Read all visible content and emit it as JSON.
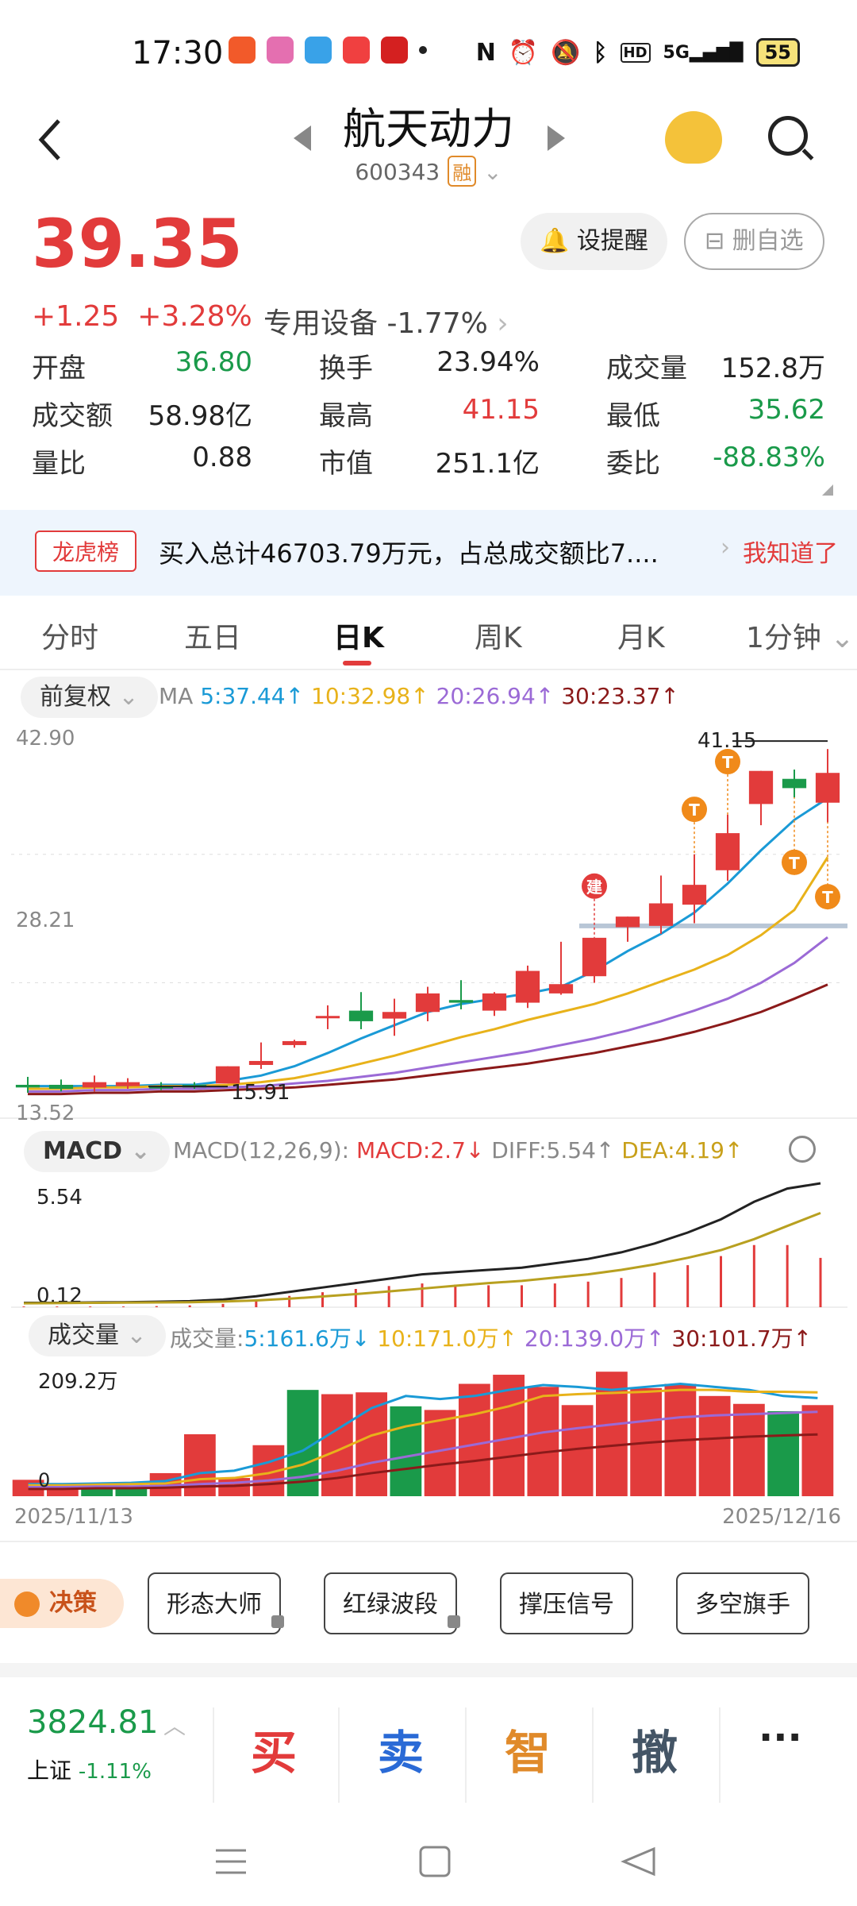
{
  "status_bar": {
    "time": "17:30",
    "network": "5G",
    "battery": "55"
  },
  "header": {
    "title": "航天动力",
    "code": "600343",
    "margin_badge": "融"
  },
  "quote": {
    "price": "39.35",
    "change": "+1.25",
    "change_pct": "+3.28%",
    "sector": "专用设备",
    "sector_change": "-1.77%",
    "alert_button": "设提醒",
    "delete_button": "删自选"
  },
  "stats": [
    {
      "label": "开盘",
      "value": "36.80",
      "color": "#1a9a4a"
    },
    {
      "label": "换手",
      "value": "23.94%",
      "color": "#222222"
    },
    {
      "label": "成交量",
      "value": "152.8万",
      "color": "#222222"
    },
    {
      "label": "成交额",
      "value": "58.98亿",
      "color": "#222222"
    },
    {
      "label": "最高",
      "value": "41.15",
      "color": "#e23b3b"
    },
    {
      "label": "最低",
      "value": "35.62",
      "color": "#1a9a4a"
    },
    {
      "label": "量比",
      "value": "0.88",
      "color": "#222222"
    },
    {
      "label": "市值",
      "value": "251.1亿",
      "color": "#222222"
    },
    {
      "label": "委比",
      "value": "-88.83%",
      "color": "#1a9a4a"
    }
  ],
  "banner": {
    "tag": "龙虎榜",
    "text": "买入总计46703.79万元，占总成交额比7....",
    "action": "我知道了"
  },
  "tabs": [
    "分时",
    "五日",
    "日K",
    "周K",
    "月K",
    "1分钟"
  ],
  "active_tab": "日K",
  "ma": {
    "adjust": "前复权",
    "label": "MA",
    "items": [
      {
        "text": "5:37.44↑",
        "color": "#1a9ad6"
      },
      {
        "text": "10:32.98↑",
        "color": "#e8b21a"
      },
      {
        "text": "20:26.94↑",
        "color": "#9b6ad6"
      },
      {
        "text": "30:23.37↑",
        "color": "#8b1a1a"
      }
    ]
  },
  "macd_header": {
    "selector": "MACD",
    "params": "MACD(12,26,9):",
    "macd": "MACD:2.7↓",
    "diff": "DIFF:5.54↑",
    "dea": "DEA:4.19↑"
  },
  "volume_header": {
    "selector": "成交量",
    "label": "成交量:",
    "items": [
      {
        "text": "5:161.6万↓",
        "color": "#1a9ad6"
      },
      {
        "text": "10:171.0万↑",
        "color": "#e8b21a"
      },
      {
        "text": "20:139.0万↑",
        "color": "#9b6ad6"
      },
      {
        "text": "30:101.7万↑",
        "color": "#8b1a1a"
      }
    ]
  },
  "chart_data": [
    {
      "type": "candlestick",
      "title": "日K",
      "ylim": [
        13.52,
        42.9
      ],
      "y_ticks": [
        "42.90",
        "28.21",
        "13.52"
      ],
      "annotations": {
        "high_label": "41.15",
        "low_label": "15.91",
        "signal_markers": [
          "建",
          "T",
          "T",
          "T",
          "T"
        ]
      },
      "candles": [
        {
          "o": 15.6,
          "h": 16.4,
          "l": 15.2,
          "c": 15.8,
          "up": false
        },
        {
          "o": 15.8,
          "h": 16.2,
          "l": 15.3,
          "c": 15.5,
          "up": false
        },
        {
          "o": 15.6,
          "h": 16.5,
          "l": 15.3,
          "c": 16.0,
          "up": true
        },
        {
          "o": 16.0,
          "h": 16.3,
          "l": 15.5,
          "c": 15.7,
          "up": true
        },
        {
          "o": 15.7,
          "h": 16.0,
          "l": 15.4,
          "c": 15.6,
          "up": false
        },
        {
          "o": 15.6,
          "h": 16.0,
          "l": 15.5,
          "c": 15.8,
          "up": false
        },
        {
          "o": 15.9,
          "h": 17.2,
          "l": 15.91,
          "c": 17.2,
          "up": true
        },
        {
          "o": 17.3,
          "h": 19.0,
          "l": 17.0,
          "c": 17.6,
          "up": true
        },
        {
          "o": 18.8,
          "h": 19.2,
          "l": 18.6,
          "c": 19.1,
          "up": true
        },
        {
          "o": 20.9,
          "h": 21.8,
          "l": 20.0,
          "c": 21.0,
          "up": true
        },
        {
          "o": 20.6,
          "h": 22.8,
          "l": 20.0,
          "c": 21.4,
          "up": false
        },
        {
          "o": 20.8,
          "h": 22.3,
          "l": 19.5,
          "c": 21.3,
          "up": true
        },
        {
          "o": 21.3,
          "h": 23.2,
          "l": 20.6,
          "c": 22.7,
          "up": true
        },
        {
          "o": 22.2,
          "h": 23.7,
          "l": 21.5,
          "c": 22.0,
          "up": false
        },
        {
          "o": 21.4,
          "h": 22.8,
          "l": 21.0,
          "c": 22.7,
          "up": true
        },
        {
          "o": 22.0,
          "h": 24.8,
          "l": 21.6,
          "c": 24.4,
          "up": true
        },
        {
          "o": 22.7,
          "h": 26.6,
          "l": 22.6,
          "c": 23.4,
          "up": true
        },
        {
          "o": 24.0,
          "h": 26.9,
          "l": 23.5,
          "c": 26.9,
          "up": true
        },
        {
          "o": 27.7,
          "h": 28.5,
          "l": 26.6,
          "c": 28.5,
          "up": true
        },
        {
          "o": 27.8,
          "h": 31.6,
          "l": 27.2,
          "c": 29.5,
          "up": true
        },
        {
          "o": 29.4,
          "h": 33.2,
          "l": 28.0,
          "c": 30.9,
          "up": true
        },
        {
          "o": 32.0,
          "h": 36.2,
          "l": 31.2,
          "c": 34.8,
          "up": true
        },
        {
          "o": 37.0,
          "h": 39.5,
          "l": 35.4,
          "c": 39.5,
          "up": true
        },
        {
          "o": 38.2,
          "h": 39.6,
          "l": 37.5,
          "c": 38.9,
          "up": false
        },
        {
          "o": 37.1,
          "h": 41.15,
          "l": 35.62,
          "c": 39.35,
          "up": true
        }
      ],
      "ma_series": [
        {
          "name": "MA5",
          "color": "#1a9ad6",
          "values": [
            15.7,
            15.7,
            15.7,
            15.7,
            15.8,
            15.8,
            16.1,
            16.5,
            17.2,
            18.2,
            19.3,
            20.3,
            21.3,
            21.9,
            22.3,
            22.7,
            23.2,
            24.4,
            25.9,
            27.2,
            28.8,
            31.0,
            33.5,
            35.8,
            37.44
          ]
        },
        {
          "name": "MA10",
          "color": "#e8b21a",
          "values": [
            15.5,
            15.5,
            15.6,
            15.6,
            15.7,
            15.7,
            15.8,
            16.0,
            16.3,
            16.8,
            17.4,
            18.0,
            18.7,
            19.4,
            20.0,
            20.7,
            21.3,
            21.9,
            22.7,
            23.6,
            24.5,
            25.6,
            27.1,
            29.0,
            32.98
          ]
        },
        {
          "name": "MA20",
          "color": "#9b6ad6",
          "values": [
            15.3,
            15.3,
            15.4,
            15.4,
            15.5,
            15.5,
            15.6,
            15.7,
            15.9,
            16.1,
            16.4,
            16.7,
            17.1,
            17.5,
            17.9,
            18.3,
            18.8,
            19.3,
            19.9,
            20.6,
            21.4,
            22.3,
            23.5,
            25.0,
            26.94
          ]
        },
        {
          "name": "MA30",
          "color": "#8b1a1a",
          "values": [
            15.1,
            15.1,
            15.2,
            15.2,
            15.3,
            15.3,
            15.4,
            15.5,
            15.6,
            15.8,
            16.0,
            16.2,
            16.5,
            16.8,
            17.1,
            17.4,
            17.8,
            18.2,
            18.7,
            19.2,
            19.8,
            20.5,
            21.3,
            22.3,
            23.37
          ]
        }
      ]
    },
    {
      "type": "macd",
      "ylim": [
        0.12,
        5.54
      ],
      "y_ticks": [
        "5.54",
        "0.12"
      ],
      "diff": [
        0.1,
        0.1,
        0.12,
        0.13,
        0.15,
        0.18,
        0.25,
        0.4,
        0.6,
        0.8,
        1.0,
        1.2,
        1.4,
        1.5,
        1.6,
        1.7,
        1.9,
        2.1,
        2.4,
        2.8,
        3.3,
        3.9,
        4.7,
        5.3,
        5.54
      ],
      "dea": [
        0.08,
        0.09,
        0.1,
        0.11,
        0.12,
        0.13,
        0.16,
        0.21,
        0.29,
        0.39,
        0.5,
        0.62,
        0.75,
        0.88,
        1.0,
        1.1,
        1.25,
        1.4,
        1.6,
        1.85,
        2.15,
        2.5,
        3.0,
        3.6,
        4.19
      ],
      "hist": [
        0.02,
        0.02,
        0.02,
        0.02,
        0.03,
        0.05,
        0.09,
        0.19,
        0.31,
        0.41,
        0.5,
        0.58,
        0.65,
        0.62,
        0.6,
        0.6,
        0.65,
        0.7,
        0.8,
        0.95,
        1.15,
        1.4,
        1.7,
        1.7,
        1.35
      ]
    },
    {
      "type": "bar",
      "title": "成交量",
      "ylim": [
        0,
        209.2
      ],
      "y_ticks": [
        "209.2万",
        "0"
      ],
      "x_labels": [
        "2025/11/13",
        "2025/12/16"
      ],
      "values": [
        27,
        19,
        18,
        14,
        38,
        102,
        30,
        84,
        175,
        168,
        171,
        148,
        142,
        185,
        200,
        180,
        150,
        205,
        178,
        185,
        165,
        152,
        140,
        150
      ],
      "up": [
        true,
        true,
        false,
        false,
        true,
        true,
        true,
        true,
        false,
        true,
        true,
        false,
        true,
        true,
        true,
        true,
        true,
        true,
        true,
        true,
        true,
        true,
        false,
        true
      ],
      "ma_series": [
        {
          "name": "MA5",
          "color": "#1a9ad6",
          "values": [
            20,
            20,
            21,
            22,
            25,
            38,
            42,
            56,
            75,
            110,
            145,
            165,
            160,
            165,
            175,
            183,
            180,
            175,
            180,
            185,
            180,
            175,
            165,
            161.6
          ]
        },
        {
          "name": "MA10",
          "color": "#e8b21a",
          "values": [
            18,
            18,
            19,
            20,
            21,
            28,
            30,
            38,
            52,
            75,
            100,
            115,
            125,
            135,
            148,
            165,
            168,
            170,
            172,
            175,
            175,
            172,
            172,
            171.0
          ]
        },
        {
          "name": "MA20",
          "color": "#9b6ad6",
          "values": [
            15,
            15,
            16,
            16,
            17,
            20,
            22,
            26,
            32,
            42,
            55,
            65,
            75,
            85,
            95,
            105,
            112,
            118,
            124,
            130,
            133,
            135,
            137,
            139.0
          ]
        },
        {
          "name": "MA30",
          "color": "#8b1a1a",
          "values": [
            12,
            12,
            13,
            13,
            14,
            16,
            17,
            20,
            24,
            30,
            38,
            45,
            52,
            58,
            65,
            72,
            78,
            83,
            88,
            92,
            95,
            98,
            100,
            101.7
          ]
        }
      ]
    }
  ],
  "bottom_tools": {
    "decision": "决策",
    "chips": [
      "形态大师",
      "红绿波段",
      "撑压信号",
      "多空旗手"
    ]
  },
  "market_index": {
    "value": "3824.81",
    "name": "上证",
    "change_pct": "-1.11%"
  },
  "trade_buttons": [
    {
      "label": "买",
      "color": "#e23b3b"
    },
    {
      "label": "卖",
      "color": "#2a6ad6"
    },
    {
      "label": "智",
      "color": "#e08a2a"
    },
    {
      "label": "撤",
      "color": "#445566"
    },
    {
      "label": "···",
      "color": "#222222"
    }
  ]
}
